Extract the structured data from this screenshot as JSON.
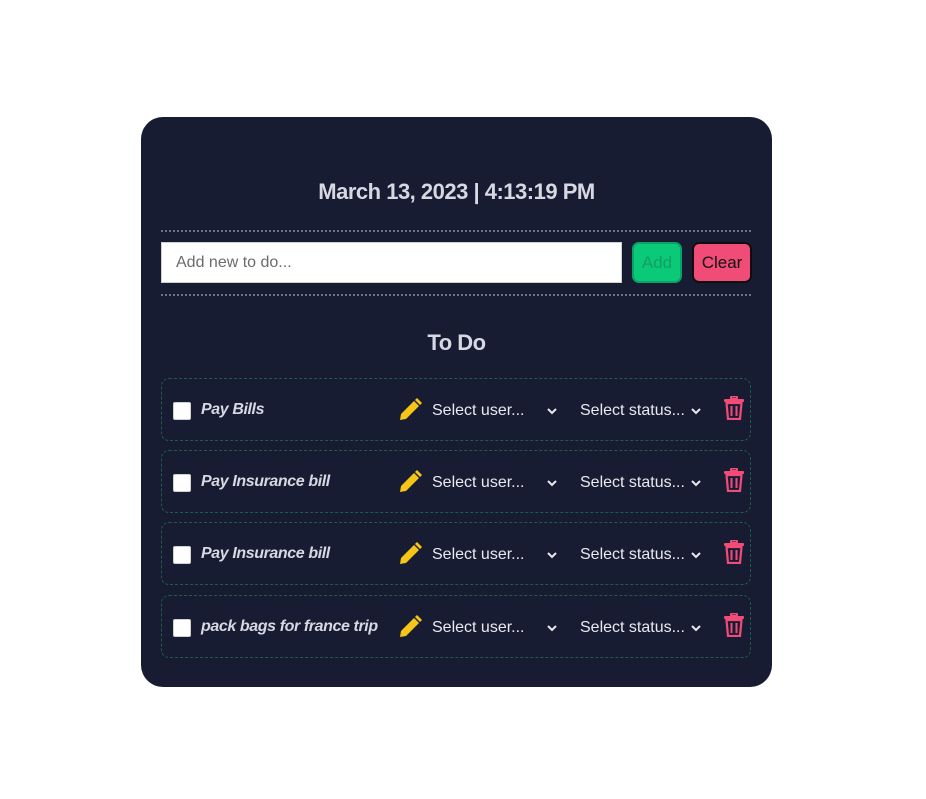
{
  "header": {
    "date": "March 13, 2023",
    "separator": "|",
    "time": "4:13:19 PM"
  },
  "new_todo": {
    "placeholder": "Add new to do...",
    "value": "",
    "add_label": "Add",
    "clear_label": "Clear"
  },
  "list": {
    "title": "To Do",
    "items": [
      {
        "text": "Pay Bills",
        "checked": false,
        "user_placeholder": "Select user...",
        "status_placeholder": "Select status..."
      },
      {
        "text": "Pay Insurance bill",
        "checked": false,
        "user_placeholder": "Select user...",
        "status_placeholder": "Select status..."
      },
      {
        "text": "Pay Insurance bill",
        "checked": false,
        "user_placeholder": "Select user...",
        "status_placeholder": "Select status..."
      },
      {
        "text": "pack bags for france trip",
        "checked": false,
        "user_placeholder": "Select user...",
        "status_placeholder": "Select status..."
      }
    ]
  },
  "icons": {
    "edit": "pencil-icon",
    "delete": "trash-icon",
    "dropdown": "chevron-down-icon"
  },
  "colors": {
    "card_background": "#181c33",
    "add_button": "#0ac978",
    "clear_button": "#f14c78",
    "edit_icon": "#f5c518",
    "trash_icon": "#f14c78",
    "row_border": "#1f5a4a"
  }
}
